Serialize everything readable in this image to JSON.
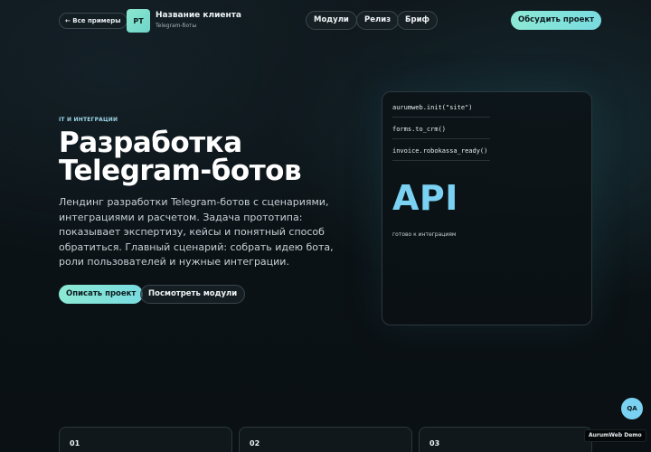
{
  "header": {
    "back_label": "← Все примеры",
    "logo_initials": "PT",
    "client_name": "Название клиента",
    "client_subtitle": "Telegram-боты",
    "nav": [
      "Модули",
      "Релиз",
      "Бриф"
    ],
    "discuss_label": "Обсудить проект"
  },
  "hero": {
    "eyebrow": "IT И ИНТЕГРАЦИИ",
    "title": "Разработка Telegram-ботов",
    "description": "Лендинг разработки Telegram-ботов с сценариями, интеграциями и расчетом. Задача прототипа: показывает экспертизу, кейсы и понятный способ обратиться. Главный сценарий: собрать идею бота, роли пользователей и нужные интеграции.",
    "primary_cta": "Описать проект",
    "secondary_cta": "Посмотреть модули"
  },
  "code_panel": {
    "lines": [
      "aurumweb.init(\"site\")",
      "forms.to_crm()",
      "invoice.robokassa_ready()"
    ],
    "highlight": "API",
    "caption": "готово к интеграциям"
  },
  "cards": [
    {
      "number": "01"
    },
    {
      "number": "02"
    },
    {
      "number": "03"
    }
  ],
  "widgets": {
    "qa_label": "QA",
    "demo_label": "AurumWeb Demo"
  },
  "colors": {
    "accent_gradient_start": "#8ce9d4",
    "accent_gradient_end": "#79dbe0",
    "api_blue": "#7ad1f2",
    "background": "#0b1216"
  }
}
